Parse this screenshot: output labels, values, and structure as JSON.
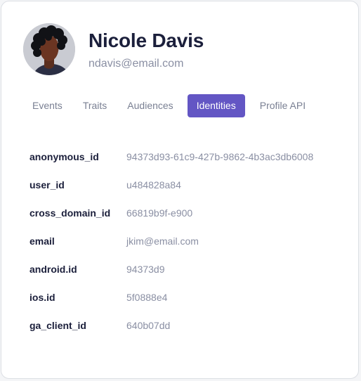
{
  "profile": {
    "name": "Nicole Davis",
    "email": "ndavis@email.com"
  },
  "tabs": [
    {
      "label": "Events",
      "active": false
    },
    {
      "label": "Traits",
      "active": false
    },
    {
      "label": "Audiences",
      "active": false
    },
    {
      "label": "Identities",
      "active": true
    },
    {
      "label": "Profile API",
      "active": false
    }
  ],
  "identities": [
    {
      "key": "anonymous_id",
      "value": "94373d93-61c9-427b-9862-4b3ac3db6008"
    },
    {
      "key": "user_id",
      "value": "u484828a84"
    },
    {
      "key": "cross_domain_id",
      "value": "66819b9f-e900"
    },
    {
      "key": "email",
      "value": "jkim@email.com"
    },
    {
      "key": "android.id",
      "value": "94373d9"
    },
    {
      "key": "ios.id",
      "value": "5f0888e4"
    },
    {
      "key": "ga_client_id",
      "value": "640b07dd"
    }
  ],
  "colors": {
    "accent": "#6356c4",
    "title": "#1b1f3b",
    "muted": "#8a8fa3"
  }
}
